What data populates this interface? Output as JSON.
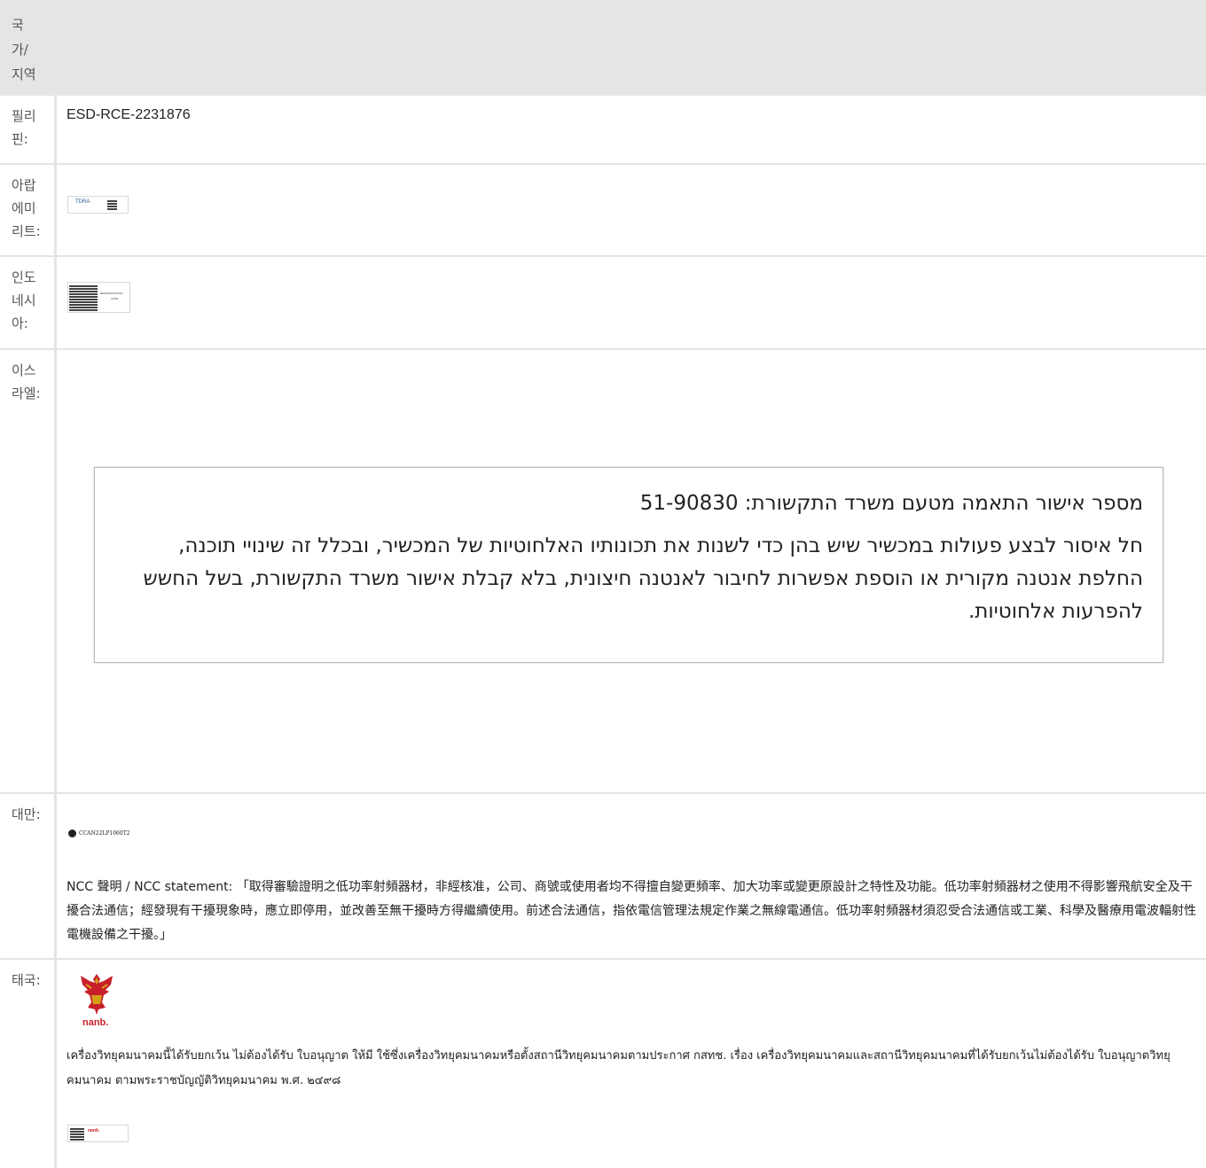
{
  "header": {
    "country_label": "국\n가/\n지역"
  },
  "rows": [
    {
      "country": "필리\n핀:",
      "value": "ESD-RCE-2231876"
    },
    {
      "country": "아랍\n에미\n리트:",
      "mark": {
        "brand": "TDRA"
      }
    },
    {
      "country": "인도\n네시\n아:",
      "mark": {
        "line1": "98623/SDPPI/2023",
        "line2": "12009"
      }
    },
    {
      "country": "이스\n라엘:",
      "hebrew": {
        "line1": "מספר אישור התאמה מטעם משרד התקשורת: 51-90830",
        "line2": "חל איסור לבצע פעולות במכשיר שיש בהן כדי לשנות את תכונותיו האלחוטיות של המכשיר, ובכלל זה שינויי תוכנה, החלפת אנטנה מקורית או הוספת אפשרות לחיבור לאנטנה חיצונית, בלא קבלת אישור משרד התקשורת, בשל החשש להפרעות אלחוטיות."
      }
    },
    {
      "country": "대만:",
      "ncc_mark": "CCAN22LP1060T2",
      "statement": "NCC 聲明 / NCC statement: 「取得審驗證明之低功率射頻器材，非經核准，公司、商號或使用者均不得擅自變更頻率、加大功率或變更原設計之特性及功能。低功率射頻器材之使用不得影響飛航安全及干擾合法通信；經發現有干擾現象時，應立即停用，並改善至無干擾時方得繼續使用。前述合法通信，指依電信管理法規定作業之無線電通信。低功率射頻器材須忍受合法通信或工業、科學及醫療用電波輻射性電機設備之干擾。」"
    },
    {
      "country": "태국:",
      "logo_label": "nanb.",
      "statement": "เครื่องวิทยุคมนาคมนี้ได้รับยกเว้น ไม่ต้องได้รับ ใบอนุญาต ให้มี ใช้ซึ่งเครื่องวิทยุคมนาคมหรือตั้งสถานีวิทยุคมนาคมตามประกาศ กสทช. เรื่อง เครื่องวิทยุคมนาคมและสถานีวิทยุคมนาคมที่ได้รับยกเว้นไม่ต้องได้รับ ใบอนุญาตวิทยุคมนาคม ตามพระราชบัญญัติวิทยุคมนาคม พ.ศ. ๒๔๙๘",
      "label_mark": {
        "brand": "nanb."
      }
    }
  ],
  "colors": {
    "header_bg": "#e5e5e5",
    "border": "#e4e4e4",
    "garuda_red": "#c8202a",
    "garuda_gold": "#d4a017"
  }
}
